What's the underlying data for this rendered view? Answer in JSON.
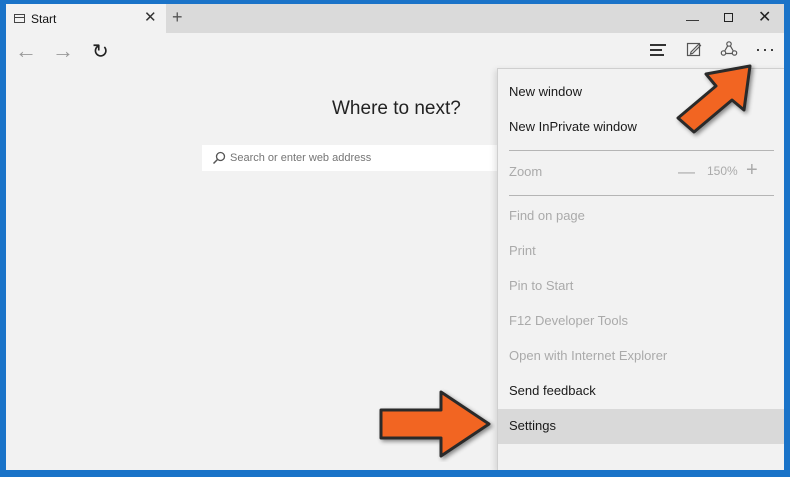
{
  "tab": {
    "title": "Start"
  },
  "window": {
    "new_tab": "+",
    "min": "—",
    "close": "✕",
    "tab_close": "✕"
  },
  "nav": {
    "back": "←",
    "forward": "→",
    "refresh": "↻",
    "more": "···"
  },
  "page": {
    "heading": "Where to next?"
  },
  "search": {
    "placeholder": "Search or enter web address",
    "value": ""
  },
  "menu": {
    "new_window": "New window",
    "new_inprivate": "New InPrivate window",
    "zoom_label": "Zoom",
    "zoom_minus": "—",
    "zoom_value": "150%",
    "zoom_plus": "+",
    "find_on_page": "Find on page",
    "print": "Print",
    "pin_to_start": "Pin to Start",
    "dev_tools": "F12 Developer Tools",
    "open_ie": "Open with Internet Explorer",
    "send_feedback": "Send feedback",
    "settings": "Settings"
  },
  "colors": {
    "background_border": "#1a73c8",
    "arrow": "#f26522",
    "menu_highlight": "#d9d9d9"
  }
}
